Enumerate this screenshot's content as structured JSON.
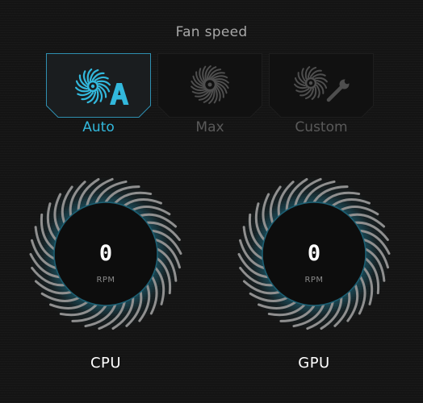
{
  "title": "Fan speed",
  "modes": [
    {
      "label": "Auto",
      "icon": "fan-auto-icon",
      "active": true
    },
    {
      "label": "Max",
      "icon": "fan-max-icon",
      "active": false
    },
    {
      "label": "Custom",
      "icon": "fan-custom-icon",
      "active": false
    }
  ],
  "fans": [
    {
      "label": "CPU",
      "value": "0",
      "unit": "RPM"
    },
    {
      "label": "GPU",
      "value": "0",
      "unit": "RPM"
    }
  ],
  "colors": {
    "accent": "#32b8dc",
    "background": "#141414",
    "inactive": "#5a5a5a"
  }
}
